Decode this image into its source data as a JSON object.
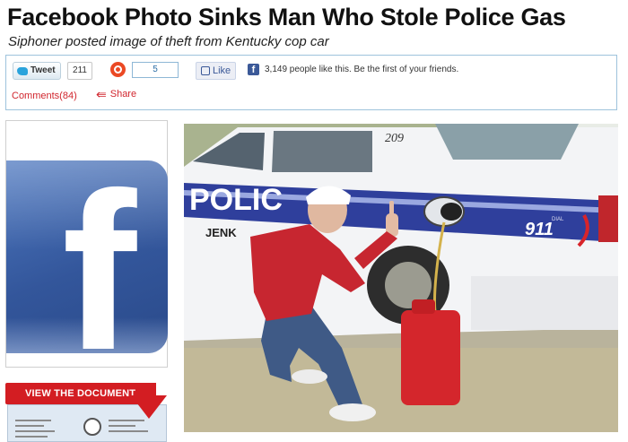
{
  "article": {
    "headline": "Facebook Photo Sinks Man Who Stole Police Gas",
    "subheadline": "Siphoner posted image of theft from Kentucky cop car"
  },
  "share_bar": {
    "tweet_label": "Tweet",
    "tweet_count": "211",
    "stumble_count": "5",
    "like_label": "Like",
    "facebook_glyph": "f",
    "like_text": "3,149 people like this. Be the first of your friends.",
    "comments_label": "Comments(84)",
    "share_label": "Share"
  },
  "sidebar": {
    "logo_glyph": "f",
    "document_button_label": "VIEW THE DOCUMENT"
  },
  "photo": {
    "car_number": "209",
    "door_text": "POLIC",
    "door_text_lower": "JENK",
    "badge_text": "911",
    "dial_text": "DIAL"
  },
  "icons": {
    "tweet": "twitter-bird-icon",
    "stumble": "stumbleupon-icon",
    "like": "thumbs-up-icon",
    "facebook": "facebook-icon",
    "share": "share-arrow-icon",
    "document": "document-arrow-icon"
  },
  "colors": {
    "link_red": "#d1262e",
    "facebook_blue": "#3b5998",
    "border_blue": "#9ec3dc"
  }
}
